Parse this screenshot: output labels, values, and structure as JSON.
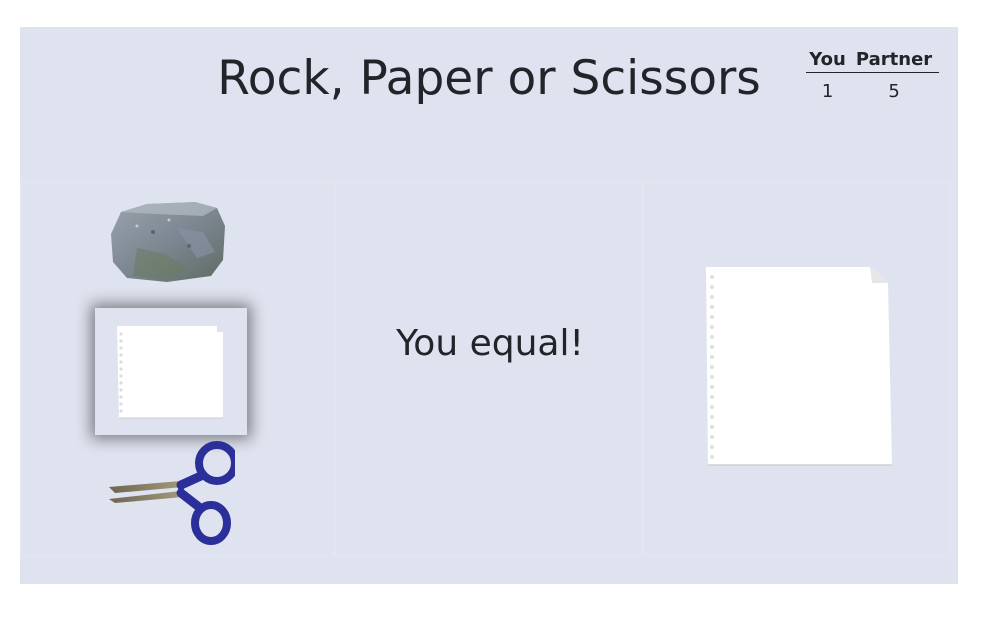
{
  "game": {
    "title": "Rock, Paper or Scissors",
    "result": "You equal!",
    "selected_choice": "paper",
    "partner_choice": "paper"
  },
  "scoreboard": {
    "you_label": "You",
    "partner_label": "Partner",
    "you_score": "1",
    "partner_score": "5"
  },
  "choices": [
    {
      "name": "rock",
      "icon": "rock-icon"
    },
    {
      "name": "paper",
      "icon": "paper-icon"
    },
    {
      "name": "scissors",
      "icon": "scissors-icon"
    }
  ],
  "colors": {
    "background": "#dfe3ef",
    "text": "#212529",
    "scissors_handle": "#2a2f9a"
  }
}
